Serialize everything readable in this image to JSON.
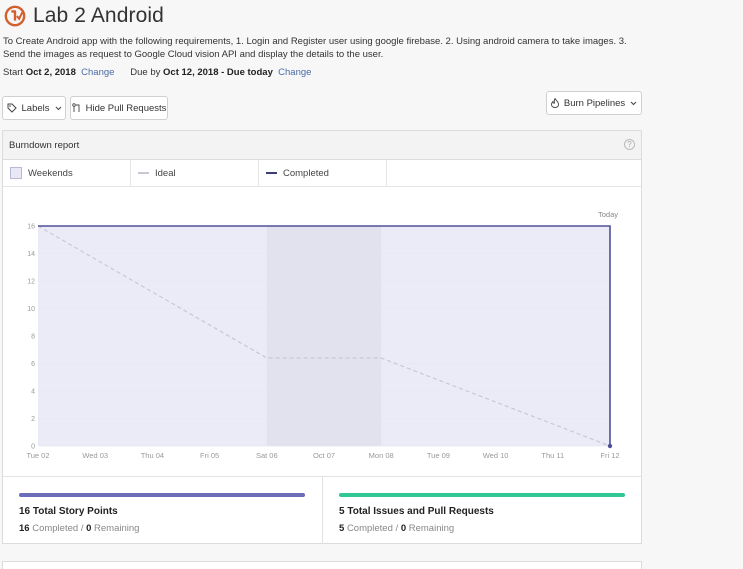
{
  "milestone": {
    "title": "Lab 2 Android",
    "description": "To Create Android app with the following requirements, 1. Login and Register user using google firebase. 2. Using android camera to take images. 3. Send the images as request to Google Cloud vision API and display the details to the user.",
    "start_label": "Start",
    "start_date": "Oct 2, 2018",
    "change_label": "Change",
    "due_label": "Due by",
    "due_date": "Oct 12, 2018 - Due today",
    "change_label_2": "Change"
  },
  "toolbar": {
    "labels_button": "Labels",
    "hide_pr_button": "Hide Pull Requests",
    "burn_pipelines_button": "Burn Pipelines"
  },
  "report": {
    "title": "Burndown report",
    "help": "?",
    "legend": {
      "weekends": "Weekends",
      "ideal": "Ideal",
      "completed": "Completed"
    },
    "today_label": "Today"
  },
  "chart_data": {
    "type": "line",
    "x": [
      "Tue 02",
      "Wed 03",
      "Thu 04",
      "Fri 05",
      "Sat 06",
      "Oct 07",
      "Mon 08",
      "Tue 09",
      "Wed 10",
      "Thu 11",
      "Fri 12"
    ],
    "yticks": [
      "0",
      "2",
      "4",
      "6",
      "8",
      "10",
      "12",
      "14",
      "16"
    ],
    "ylim": [
      0,
      16
    ],
    "weekend_span": [
      "Sat 06",
      "Mon 08"
    ],
    "today_index": 10,
    "series": [
      {
        "name": "Ideal",
        "values": [
          16,
          13.6,
          11.2,
          8.8,
          6.4,
          6.4,
          6.4,
          4.8,
          3.2,
          1.6,
          0
        ],
        "color": "#c8c8d2",
        "dashed": true
      },
      {
        "name": "Completed",
        "values": [
          16,
          16,
          16,
          16,
          16,
          16,
          16,
          16,
          16,
          16,
          16
        ],
        "color": "#4e5099",
        "dashed": false
      }
    ],
    "fill_color": "#e8e8f6"
  },
  "stats": {
    "story_points": {
      "title": "16 Total Story Points",
      "completed_count": "16",
      "completed_label": "Completed",
      "separator": "/",
      "remaining_count": "0",
      "remaining_label": "Remaining",
      "bar_color": "#6b6db8",
      "progress": 1.0
    },
    "issues": {
      "title": "5 Total Issues and Pull Requests",
      "completed_count": "5",
      "completed_label": "Completed",
      "separator": "/",
      "remaining_count": "0",
      "remaining_label": "Remaining",
      "bar_color": "#2fc796",
      "progress": 1.0
    }
  },
  "colors": {
    "logo": "#d35f2e",
    "link": "#4a6ca5"
  },
  "icons": {
    "logo": "milestone-logo-icon",
    "labels": "tag-icon",
    "chevron": "chevron-down-icon",
    "pull_request": "pull-request-icon",
    "fire": "fire-icon"
  }
}
